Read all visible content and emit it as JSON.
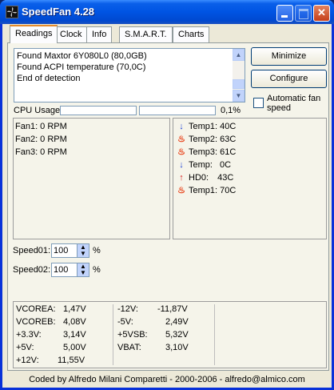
{
  "window": {
    "title": "SpeedFan 4.28"
  },
  "tabs": [
    "Readings",
    "Clock",
    "Info",
    "S.M.A.R.T.",
    "Charts"
  ],
  "log": [
    "Found Maxtor 6Y080L0 (80,0GB)",
    "Found ACPI temperature (70,0C)",
    "End of detection"
  ],
  "buttons": {
    "minimize": "Minimize",
    "configure": "Configure"
  },
  "auto_fan_speed": {
    "label": "Automatic fan speed",
    "checked": false
  },
  "cpu": {
    "label": "CPU Usage",
    "percent": "0,1%",
    "bar1_fraction": 0.0,
    "bar2_fraction": 0.0
  },
  "fans": [
    "Fan1: 0 RPM",
    "Fan2: 0 RPM",
    "Fan3: 0 RPM"
  ],
  "temps": [
    {
      "icon": "arrow-down-icon",
      "label": "Temp1:",
      "value": "40C"
    },
    {
      "icon": "flame-icon",
      "label": "Temp2:",
      "value": "63C"
    },
    {
      "icon": "flame-icon",
      "label": "Temp3:",
      "value": "61C"
    },
    {
      "icon": "arrow-down-icon",
      "label": "Temp:",
      "value": "0C"
    },
    {
      "icon": "arrow-up-icon",
      "label": "HD0:",
      "value": "43C"
    },
    {
      "icon": "flame-icon",
      "label": "Temp1:",
      "value": "70C"
    }
  ],
  "speeds": [
    {
      "label": "Speed01:",
      "value": "100",
      "unit": "%"
    },
    {
      "label": "Speed02:",
      "value": "100",
      "unit": "%"
    }
  ],
  "voltages_left": [
    {
      "label": "VCOREA:",
      "value": "1,47V"
    },
    {
      "label": "VCOREB:",
      "value": "4,08V"
    },
    {
      "label": "+3.3V:",
      "value": "3,14V"
    },
    {
      "label": "+5V:",
      "value": "5,00V"
    },
    {
      "label": "+12V:",
      "value": "11,55V"
    }
  ],
  "voltages_right": [
    {
      "label": "-12V:",
      "value": "-11,87V"
    },
    {
      "label": "-5V:",
      "value": "2,49V"
    },
    {
      "label": "+5VSB:",
      "value": "5,32V"
    },
    {
      "label": "VBAT:",
      "value": "3,10V"
    }
  ],
  "footer": "Coded by Alfredo Milani Comparetti - 2000-2006 - alfredo@almico.com",
  "colors": {
    "titlebar": "#0054e3",
    "flame": "#e8421a",
    "arrow_down": "#1a3fd6",
    "arrow_up": "#d61a1a"
  }
}
